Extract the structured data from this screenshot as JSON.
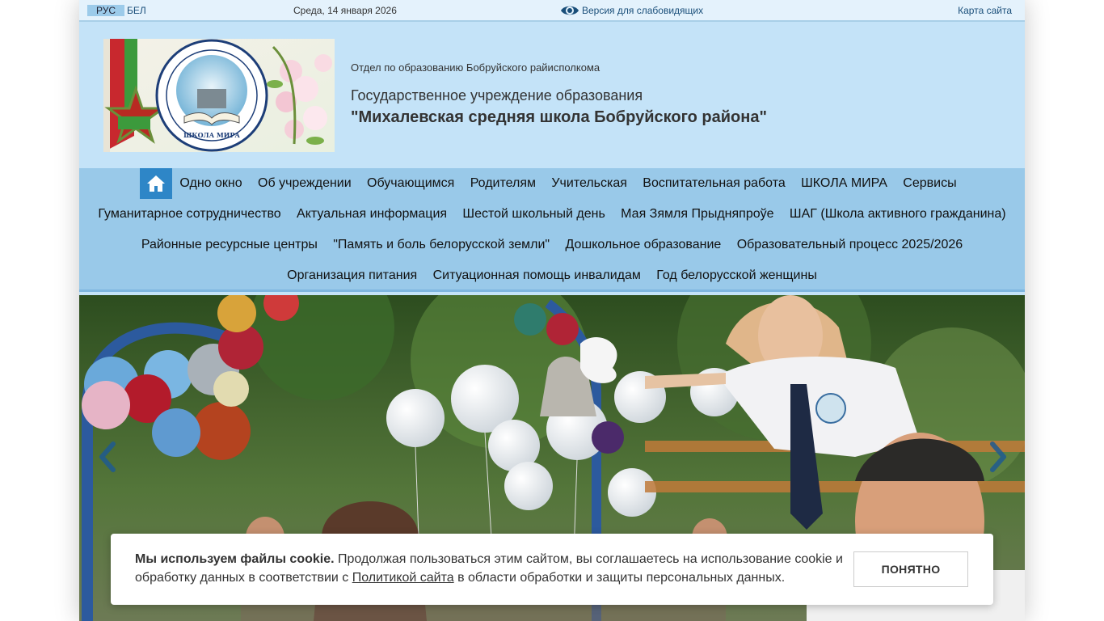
{
  "topbar": {
    "lang_ru": "РУС",
    "lang_by": "БЕЛ",
    "date": "Среда, 14 января 2026",
    "vision_label": "Версия для слабовидящих",
    "sitemap": "Карта сайта"
  },
  "header": {
    "department": "Отдел по образованию Бобруйского райисполкома",
    "institution": "Государственное учреждение образования",
    "school_name": "\"Михалевская средняя школа Бобруйского района\"",
    "logo_caption": "ШКОЛА МИРА"
  },
  "nav": {
    "rows": [
      [
        "Одно окно",
        "Об учреждении",
        "Обучающимся",
        "Родителям",
        "Учительская",
        "Воспитательная работа",
        "ШКОЛА МИРА",
        "Сервисы"
      ],
      [
        "Гуманитарное сотрудничество",
        "Актуальная информация",
        "Шестой школьный день",
        "Мая Зямля Прыдняпроўе",
        "ШАГ (Школа активного гражданина)"
      ],
      [
        "Районные ресурсные центры",
        "\"Память и боль белорусской земли\"",
        "Дошкольное образование",
        "Образовательный процесс 2025/2026"
      ],
      [
        "Организация питания",
        "Ситуационная помощь инвалидам",
        "Год белорусской женщины"
      ]
    ]
  },
  "cookie": {
    "bold": "Мы используем файлы cookie.",
    "text1": " Продолжая пользоваться этим сайтом, вы соглашаетесь на использование cookie и обработку данных в соответствии с ",
    "link": "Политикой сайта",
    "text2": " в области обработки и защиты персональных данных.",
    "button": "ПОНЯТНО"
  },
  "colors": {
    "page_bg": "#c4e3f8",
    "nav_bg": "#99c9e9",
    "home_btn": "#2e86c7",
    "link": "#1a4f7a"
  },
  "icons": [
    "eye-icon",
    "home-icon",
    "chevron-left-icon",
    "chevron-right-icon"
  ]
}
